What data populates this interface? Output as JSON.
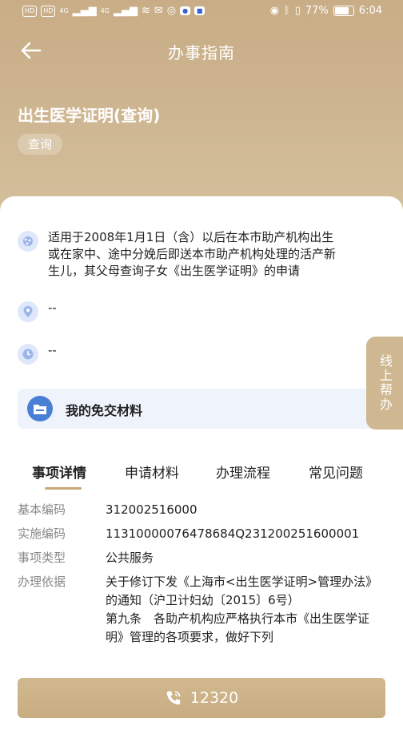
{
  "status_bar": {
    "left_badges": [
      "HD",
      "HD"
    ],
    "net1": "4G",
    "net2": "4G",
    "battery": "77%",
    "time": "6:04"
  },
  "nav": {
    "title": "办事指南",
    "back_icon": "arrow-left-icon"
  },
  "item": {
    "title": "出生医学证明(查询)",
    "tag": "查询"
  },
  "info": {
    "scope": "适用于2008年1月1日（含）以后在本市助产机构出生或在家中、途中分娩后即送本市助产机构处理的活产新生儿，其父母查询子女《出生医学证明》的申请",
    "location": "--",
    "time": "--"
  },
  "float_help": "线上帮办",
  "materials": {
    "label": "我的免交材料"
  },
  "tabs": [
    "事项详情",
    "申请材料",
    "办理流程",
    "常见问题"
  ],
  "details": {
    "basic_code_label": "基本编码",
    "basic_code": "312002516000",
    "impl_code_label": "实施编码",
    "impl_code": "11310000076478684Q231200251600001",
    "type_label": "事项类型",
    "type": "公共服务",
    "basis_label": "办理依据",
    "basis": "关于修订下发《上海市<出生医学证明>管理办法》的通知（沪卫计妇幼〔2015〕6号）\n第九条　各助产机构应严格执行本市《出生医学证明》管理的各项要求，做好下列"
  },
  "call": {
    "number": "12320",
    "icon": "phone-icon"
  },
  "colors": {
    "accent": "#c9ad86",
    "blue": "#4a7fd6"
  }
}
